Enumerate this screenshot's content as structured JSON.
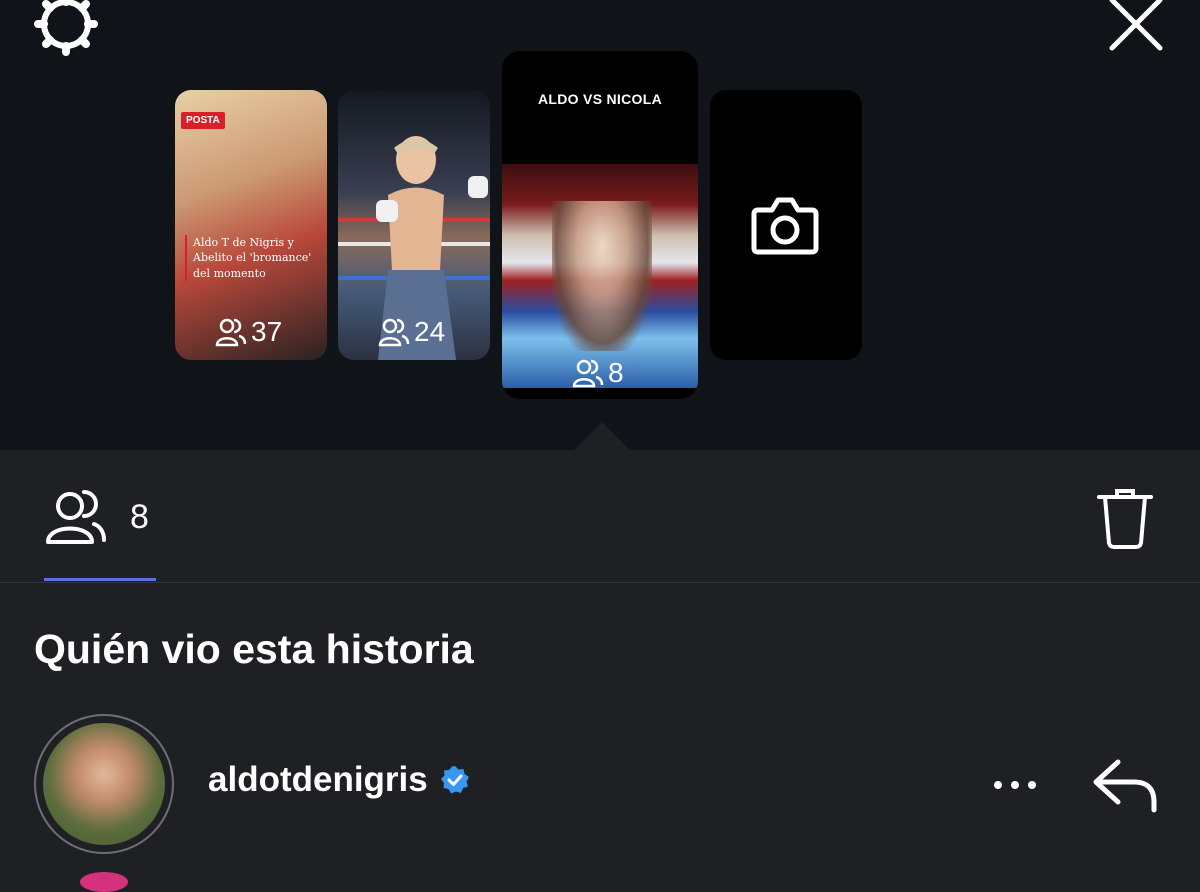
{
  "header": {
    "settings_icon": "gear-icon",
    "close_icon": "close-icon"
  },
  "stories": [
    {
      "brand": "POSTA",
      "headline": "Aldo T de Nigris y Abelito el 'bromance' del momento",
      "viewers": "37"
    },
    {
      "viewers": "24"
    },
    {
      "title": "ALDO VS NICOLA",
      "viewers": "8",
      "selected": true
    },
    {
      "type": "camera",
      "icon": "camera-icon"
    }
  ],
  "tabs": {
    "viewers_count": "8",
    "viewers_icon": "viewers-icon",
    "delete_icon": "trash-icon",
    "accent": "#5b6fe0"
  },
  "section": {
    "title": "Quién vio esta historia"
  },
  "viewers": [
    {
      "username": "aldotdenigris",
      "verified": true,
      "more_icon": "more-icon",
      "reply_icon": "reply-icon"
    }
  ],
  "colors": {
    "top_bg": "#101318",
    "panel_bg": "#1f2024",
    "verified_blue": "#3897f0"
  }
}
